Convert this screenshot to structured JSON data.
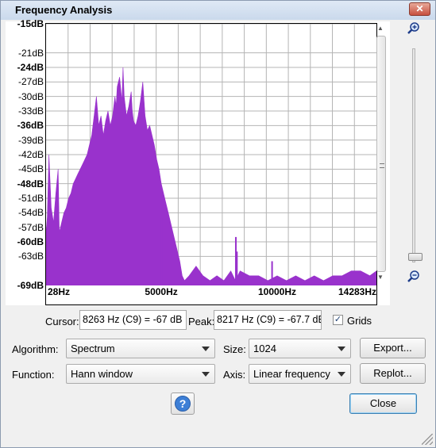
{
  "window": {
    "title": "Frequency Analysis",
    "close_glyph": "✕"
  },
  "chart_data": {
    "type": "area",
    "xlabel": "",
    "ylabel": "",
    "x_ticks": [
      "28Hz",
      "5000Hz",
      "10000Hz",
      "14283Hz"
    ],
    "y_ticks": [
      "-15dB",
      "-21dB",
      "-24dB",
      "-27dB",
      "-30dB",
      "-33dB",
      "-36dB",
      "-39dB",
      "-42dB",
      "-45dB",
      "-48dB",
      "-51dB",
      "-54dB",
      "-57dB",
      "-60dB",
      "-63dB",
      "-69dB"
    ],
    "y_bold_ticks": [
      "-15dB",
      "-24dB",
      "-36dB",
      "-48dB",
      "-60dB",
      "-69dB"
    ],
    "xlim": [
      28,
      14283
    ],
    "ylim": [
      -69,
      -15
    ],
    "grid": true,
    "fill_color": "#9932cc",
    "series": [
      {
        "x": [
          28,
          80,
          150,
          250,
          350,
          450,
          550,
          600,
          700,
          800,
          900,
          1000,
          1100,
          1200,
          1300,
          1400,
          1500,
          1600,
          1700,
          1800,
          1900,
          2000,
          2100,
          2200,
          2300,
          2400,
          2500,
          2600,
          2700,
          2800,
          2900,
          3000,
          3050,
          3100,
          3200,
          3300,
          3350,
          3400,
          3500,
          3600,
          3700,
          3750,
          3800,
          3900,
          4000,
          4100,
          4200,
          4300,
          4400,
          4500,
          4600,
          4700,
          4800,
          4900,
          5000,
          5100,
          5200,
          5300,
          5400,
          5500,
          5600,
          5700,
          5800,
          5900,
          6000,
          6200,
          6500,
          6800,
          7100,
          7400,
          7700,
          8000,
          8200,
          8400,
          8800,
          9200,
          9600,
          10000,
          10400,
          10800,
          11200,
          11600,
          12000,
          12400,
          12800,
          13200,
          13600,
          14000,
          14283
        ],
        "y": [
          -58,
          -55,
          -42,
          -53,
          -56,
          -50,
          -45,
          -58,
          -56,
          -54,
          -53,
          -51,
          -50,
          -48,
          -47,
          -46,
          -45,
          -44,
          -43,
          -42,
          -40,
          -38,
          -34,
          -30,
          -36,
          -34,
          -38,
          -35,
          -33,
          -36,
          -34,
          -30,
          -32,
          -28,
          -26,
          -31,
          -24,
          -30,
          -34,
          -32,
          -29,
          -33,
          -35,
          -36,
          -34,
          -31,
          -27,
          -34,
          -37,
          -36,
          -38,
          -40,
          -43,
          -45,
          -48,
          -50,
          -52,
          -54,
          -56,
          -58,
          -60,
          -62,
          -64,
          -67,
          -68,
          -67,
          -65,
          -67,
          -68,
          -67,
          -68,
          -66,
          -68,
          -66,
          -67,
          -67,
          -68,
          -67,
          -68,
          -67,
          -68,
          -67,
          -68,
          -67,
          -67,
          -66,
          -66,
          -67,
          -66
        ]
      }
    ],
    "spikes": [
      {
        "x": 8217,
        "y": -59
      },
      {
        "x": 8263,
        "y": -62
      },
      {
        "x": 9780,
        "y": -64
      },
      {
        "x": 5000,
        "y": -55
      }
    ]
  },
  "controls": {
    "cursor_label": "Cursor:",
    "cursor_value": "8263 Hz (C9) = -67 dB",
    "peak_label": "Peak:",
    "peak_value": "8217 Hz (C9) = -67.7 dB",
    "grids_label": "Grids",
    "grids_checked": "✓",
    "algorithm_label": "Algorithm:",
    "algorithm_value": "Spectrum",
    "size_label": "Size:",
    "size_value": "1024",
    "function_label": "Function:",
    "function_value": "Hann window",
    "axis_label": "Axis:",
    "axis_value": "Linear frequency",
    "export_label": "Export...",
    "replot_label": "Replot...",
    "help_label": "?",
    "close_label": "Close"
  },
  "zoom": {
    "zoom_in_icon": "zoom-in-icon",
    "zoom_out_icon": "zoom-out-icon"
  }
}
